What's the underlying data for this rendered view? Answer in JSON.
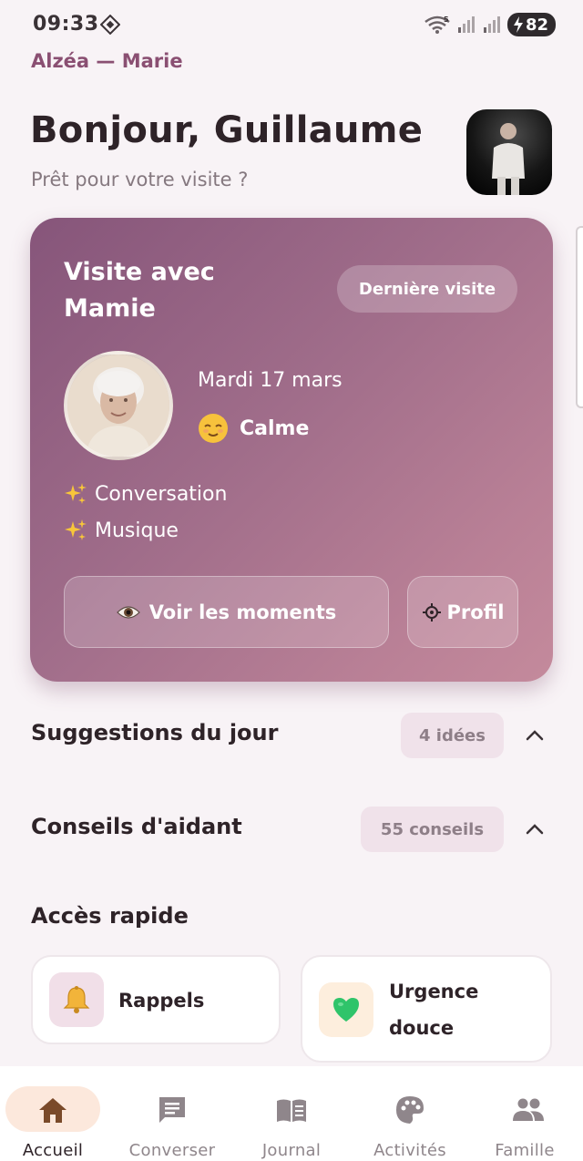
{
  "status_bar": {
    "time": "09:33",
    "network_badge": "5",
    "battery": "82"
  },
  "app": {
    "subtitle": "Alzéa — Marie"
  },
  "header": {
    "greeting": "Bonjour, Guillaume",
    "subtitle": "Prêt pour votre visite ?"
  },
  "visit_card": {
    "title": "Visite avec Mamie",
    "last_visit_label": "Dernière visite",
    "date": "Mardi 17 mars",
    "mood": "Calme",
    "mood_icon": "relieved-face-icon",
    "tags": [
      "Conversation",
      "Musique"
    ],
    "moments_button": "Voir les moments",
    "profile_button": "Profil",
    "gradient_start": "#86557a",
    "gradient_end": "#c48a9c"
  },
  "sections": {
    "suggestions": {
      "title": "Suggestions du jour",
      "count_label": "4 idées"
    },
    "tips": {
      "title": "Conseils d'aidant",
      "count_label": "55 conseils"
    },
    "quick_access": {
      "title": "Accès rapide",
      "items": [
        {
          "label": "Rappels",
          "icon": "bell-icon"
        },
        {
          "label_line1": "Urgence",
          "label_line2": "douce",
          "icon": "green-heart-icon"
        }
      ]
    }
  },
  "bottom_nav": {
    "items": [
      {
        "label": "Accueil",
        "icon": "home-icon",
        "active": true
      },
      {
        "label": "Converser",
        "icon": "chat-icon",
        "active": false
      },
      {
        "label": "Journal",
        "icon": "book-icon",
        "active": false
      },
      {
        "label": "Activités",
        "icon": "palette-icon",
        "active": false
      },
      {
        "label": "Famille",
        "icon": "people-icon",
        "active": false
      }
    ],
    "active_color": "#7a4a2a",
    "inactive_color": "#8f868b"
  }
}
